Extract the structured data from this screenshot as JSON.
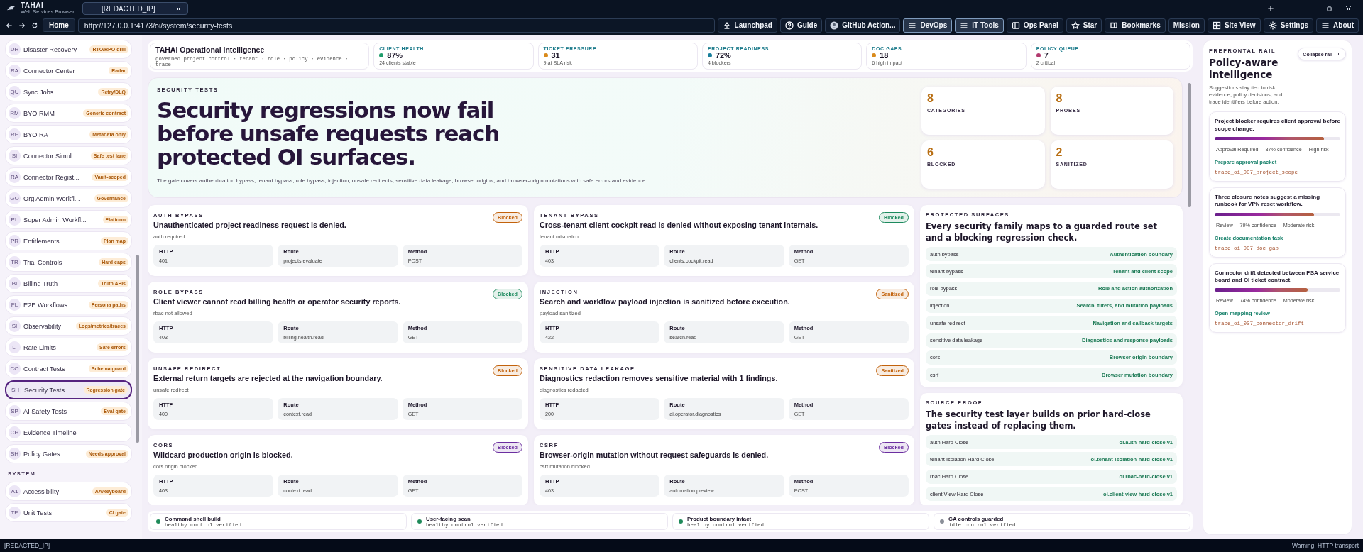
{
  "browser": {
    "logo": "TAHAI",
    "subtitle": "Web Services Browser",
    "tabs": [
      {
        "label": "[REDACTED_IP]",
        "selected": true
      }
    ],
    "home": "Home",
    "url": "http://127.0.0.1:4173/oi/system/security-tests",
    "toolbar": [
      {
        "label": "Launchpad",
        "highlighted": false
      },
      {
        "label": "Guide",
        "highlighted": false
      },
      {
        "label": "GitHub Action...",
        "highlighted": false
      },
      {
        "label": "DevOps",
        "highlighted": true
      },
      {
        "label": "IT Tools",
        "highlighted": true
      },
      {
        "label": "Ops Panel",
        "highlighted": false
      },
      {
        "label": "Star",
        "highlighted": false
      },
      {
        "label": "Bookmarks",
        "highlighted": false
      },
      {
        "label": "Mission",
        "highlighted": false
      },
      {
        "label": "Site View",
        "highlighted": false
      },
      {
        "label": "Settings",
        "highlighted": false
      },
      {
        "label": "About",
        "highlighted": false
      }
    ]
  },
  "sidebar": {
    "sections": [
      {
        "items": [
          {
            "abbr": "DR",
            "label": "Disaster Recovery",
            "badge": "RTO/RPO drill",
            "selected": false
          },
          {
            "abbr": "RA",
            "label": "Connector Center",
            "badge": "Radar",
            "selected": false
          },
          {
            "abbr": "QU",
            "label": "Sync Jobs",
            "badge": "Retry/DLQ",
            "selected": false
          },
          {
            "abbr": "RM",
            "label": "BYO RMM",
            "badge": "Generic contract",
            "selected": false
          },
          {
            "abbr": "RE",
            "label": "BYO RA",
            "badge": "Metadata only",
            "selected": false
          },
          {
            "abbr": "SI",
            "label": "Connector Simul...",
            "badge": "Safe test lane",
            "selected": false
          },
          {
            "abbr": "RA",
            "label": "Connector Regist...",
            "badge": "Vault-scoped",
            "selected": false
          },
          {
            "abbr": "GO",
            "label": "Org Admin Workfl...",
            "badge": "Governance",
            "selected": false
          },
          {
            "abbr": "PL",
            "label": "Super Admin Workfl...",
            "badge": "Platform",
            "selected": false
          },
          {
            "abbr": "PR",
            "label": "Entitlements",
            "badge": "Plan map",
            "selected": false
          },
          {
            "abbr": "TR",
            "label": "Trial Controls",
            "badge": "Hard caps",
            "selected": false
          },
          {
            "abbr": "BI",
            "label": "Billing Truth",
            "badge": "Truth APIs",
            "selected": false
          },
          {
            "abbr": "FL",
            "label": "E2E Workflows",
            "badge": "Persona paths",
            "selected": false
          },
          {
            "abbr": "SI",
            "label": "Observability",
            "badge": "Logs/metrics/traces",
            "selected": false
          },
          {
            "abbr": "LI",
            "label": "Rate Limits",
            "badge": "Safe errors",
            "selected": false
          },
          {
            "abbr": "CO",
            "label": "Contract Tests",
            "badge": "Schema guard",
            "selected": false
          },
          {
            "abbr": "SH",
            "label": "Security Tests",
            "badge": "Regression gate",
            "selected": true
          },
          {
            "abbr": "SP",
            "label": "AI Safety Tests",
            "badge": "Eval gate",
            "selected": false
          },
          {
            "abbr": "CH",
            "label": "Evidence Timeline",
            "selected": false
          },
          {
            "abbr": "SH",
            "label": "Policy Gates",
            "badge": "Needs approval",
            "selected": false
          }
        ]
      },
      {
        "title": "SYSTEM",
        "items": [
          {
            "abbr": "A1",
            "label": "Accessibility",
            "badge": "AA/keyboard",
            "selected": false
          },
          {
            "abbr": "TE",
            "label": "Unit Tests",
            "badge": "CI gate",
            "selected": false
          }
        ]
      }
    ]
  },
  "header": {
    "title": "TAHAI Operational Intelligence",
    "subtitle": "governed project control · tenant · role · policy · evidence · trace",
    "stats": [
      {
        "label": "CLIENT HEALTH",
        "value": "87%",
        "note": "24 clients stable",
        "color": "#1f9d6b"
      },
      {
        "label": "TICKET PRESSURE",
        "value": "31",
        "note": "9 at SLA risk",
        "color": "#d98a1c"
      },
      {
        "label": "PROJECT READINESS",
        "value": "72%",
        "note": "4 blockers",
        "color": "#1a7f9c"
      },
      {
        "label": "DOC GAPS",
        "value": "18",
        "note": "6 high impact",
        "color": "#d98a1c"
      },
      {
        "label": "POLICY QUEUE",
        "value": "7",
        "note": "2 critical",
        "color": "#b23a6e"
      }
    ]
  },
  "hero": {
    "kicker": "SECURITY TESTS",
    "title": "Security regressions now fail before unsafe requests reach protected OI surfaces.",
    "description": "The gate covers authentication bypass, tenant bypass, role bypass, injection, unsafe redirects, sensitive data leakage, browser origins, and browser-origin mutations with safe errors and evidence.",
    "tiles": [
      {
        "value": "8",
        "label": "CATEGORIES"
      },
      {
        "value": "8",
        "label": "PROBES"
      },
      {
        "value": "6",
        "label": "BLOCKED"
      },
      {
        "value": "2",
        "label": "SANITIZED"
      }
    ]
  },
  "cards": [
    {
      "kicker": "AUTH BYPASS",
      "title": "Unauthenticated project readiness request is denied.",
      "sub": "auth required",
      "badge": "Blocked",
      "color": "#c2620c",
      "metrics": [
        {
          "label": "HTTP",
          "value": "401"
        },
        {
          "label": "Route",
          "value": "projects.evaluate"
        },
        {
          "label": "Method",
          "value": "POST"
        }
      ]
    },
    {
      "kicker": "TENANT BYPASS",
      "title": "Cross-tenant client cockpit read is denied without exposing tenant internals.",
      "sub": "tenant mismatch",
      "badge": "Blocked",
      "color": "#1d8a5e",
      "metrics": [
        {
          "label": "HTTP",
          "value": "403"
        },
        {
          "label": "Route",
          "value": "clients.cockpit.read"
        },
        {
          "label": "Method",
          "value": "GET"
        }
      ]
    },
    {
      "kicker": "ROLE BYPASS",
      "title": "Client viewer cannot read billing health or operator security reports.",
      "sub": "rbac not allowed",
      "badge": "Blocked",
      "color": "#1d8a5e",
      "metrics": [
        {
          "label": "HTTP",
          "value": "403"
        },
        {
          "label": "Route",
          "value": "billing.health.read"
        },
        {
          "label": "Method",
          "value": "GET"
        }
      ]
    },
    {
      "kicker": "INJECTION",
      "title": "Search and workflow payload injection is sanitized before execution.",
      "sub": "payload sanitized",
      "badge": "Sanitized",
      "color": "#c2620c",
      "metrics": [
        {
          "label": "HTTP",
          "value": "422"
        },
        {
          "label": "Route",
          "value": "search.read"
        },
        {
          "label": "Method",
          "value": "GET"
        }
      ]
    },
    {
      "kicker": "UNSAFE REDIRECT",
      "title": "External return targets are rejected at the navigation boundary.",
      "sub": "unsafe redirect",
      "badge": "Blocked",
      "color": "#c2620c",
      "metrics": [
        {
          "label": "HTTP",
          "value": "400"
        },
        {
          "label": "Route",
          "value": "context.read"
        },
        {
          "label": "Method",
          "value": "GET"
        }
      ]
    },
    {
      "kicker": "SENSITIVE DATA LEAKAGE",
      "title": "Diagnostics redaction removes sensitive material with 1 findings.",
      "sub": "diagnostics redacted",
      "badge": "Sanitized",
      "color": "#c2620c",
      "metrics": [
        {
          "label": "HTTP",
          "value": "200"
        },
        {
          "label": "Route",
          "value": "ai.operator.diagnostics"
        },
        {
          "label": "Method",
          "value": "GET"
        }
      ]
    },
    {
      "kicker": "CORS",
      "title": "Wildcard production origin is blocked.",
      "sub": "cors origin blocked",
      "badge": "Blocked",
      "color": "#6b2fa0",
      "metrics": [
        {
          "label": "HTTP",
          "value": "403"
        },
        {
          "label": "Route",
          "value": "context.read"
        },
        {
          "label": "Method",
          "value": "GET"
        }
      ]
    },
    {
      "kicker": "CSRF",
      "title": "Browser-origin mutation without request safeguards is denied.",
      "sub": "csrf mutation blocked",
      "badge": "Blocked",
      "color": "#6b2fa0",
      "metrics": [
        {
          "label": "HTTP",
          "value": "403"
        },
        {
          "label": "Route",
          "value": "automation.preview"
        },
        {
          "label": "Method",
          "value": "POST"
        }
      ]
    }
  ],
  "protected_surfaces": {
    "kicker": "PROTECTED SURFACES",
    "title": "Every security family maps to a guarded route set and a blocking regression check.",
    "rows": [
      {
        "name": "auth bypass",
        "value": "Authentication boundary"
      },
      {
        "name": "tenant bypass",
        "value": "Tenant and client scope"
      },
      {
        "name": "role bypass",
        "value": "Role and action authorization"
      },
      {
        "name": "injection",
        "value": "Search, filters, and mutation payloads"
      },
      {
        "name": "unsafe redirect",
        "value": "Navigation and callback targets"
      },
      {
        "name": "sensitive data leakage",
        "value": "Diagnostics and response payloads"
      },
      {
        "name": "cors",
        "value": "Browser origin boundary"
      },
      {
        "name": "csrf",
        "value": "Browser mutation boundary"
      }
    ]
  },
  "source_proof": {
    "kicker": "SOURCE PROOF",
    "title": "The security test layer builds on prior hard-close gates instead of replacing them.",
    "rows": [
      {
        "name": "auth Hard Close",
        "value": "oi.auth-hard-close.v1"
      },
      {
        "name": "tenant Isolation Hard Close",
        "value": "oi.tenant-isolation-hard-close.v1"
      },
      {
        "name": "rbac Hard Close",
        "value": "oi.rbac-hard-close.v1"
      },
      {
        "name": "client View Hard Close",
        "value": "oi.client-view-hard-close.v1"
      }
    ]
  },
  "controls": [
    {
      "title": "Command shell build",
      "note": "healthy control verified",
      "color": "#1f8a5a"
    },
    {
      "title": "User-facing scan",
      "note": "healthy control verified",
      "color": "#1f8a5a"
    },
    {
      "title": "Product boundary intact",
      "note": "healthy control verified",
      "color": "#1f8a5a"
    },
    {
      "title": "GA controls guarded",
      "note": "idle control verified",
      "color": "#8a8f98"
    }
  ],
  "rail": {
    "kicker": "PREFRONTAL RAIL",
    "title": "Policy-aware intelligence",
    "button": "Collapse rail",
    "description": "Suggestions stay tied to risk, evidence, policy decisions, and trace identifiers before action.",
    "cards": [
      {
        "title": "Project blocker requires client approval before scope change.",
        "level": 0.87,
        "meta": [
          "Approval Required",
          "87% confidence",
          "High risk"
        ],
        "action": "Prepare approval packet",
        "trace": "trace_oi_007_project_scope"
      },
      {
        "title": "Three closure notes suggest a missing runbook for VPN reset workflow.",
        "level": 0.79,
        "meta": [
          "Review",
          "79% confidence",
          "Moderate risk"
        ],
        "action": "Create documentation task",
        "trace": "trace_oi_007_doc_gap"
      },
      {
        "title": "Connector drift detected between PSA service board and OI ticket contract.",
        "level": 0.74,
        "meta": [
          "Review",
          "74% confidence",
          "Moderate risk"
        ],
        "action": "Open mapping review",
        "trace": "trace_oi_007_connector_drift"
      }
    ]
  },
  "status_bar": {
    "left": "[REDACTED_IP]",
    "right": "Warning: HTTP transport"
  }
}
